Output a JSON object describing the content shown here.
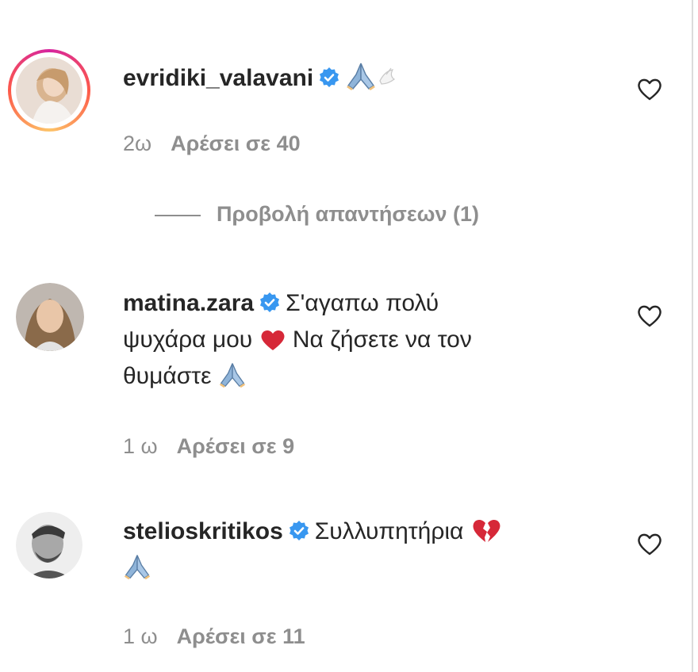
{
  "comments": [
    {
      "username": "evridiki_valavani",
      "text": "",
      "emoji": "praying-hands, dove",
      "age": "2ω",
      "likes": "Αρέσει σε 40",
      "has_story_ring": true,
      "view_replies": "Προβολή απαντήσεων (1)"
    },
    {
      "username": "matina.zara",
      "text_line1": "Σ'αγαπω πολύ",
      "text_line2a": "ψυχάρα μου",
      "text_line2b": "Να ζήσετε να τον",
      "text_line3": "θυμάστε",
      "age": "1 ω",
      "likes": "Αρέσει σε 9"
    },
    {
      "username": "stelioskritikos",
      "text": "Συλλυπητήρια",
      "age": "1 ω",
      "likes": "Αρέσει σε 11"
    }
  ],
  "colors": {
    "text": "#262626",
    "secondary": "#8e8e8e",
    "verified": "#3897f0",
    "heart_red": "#e0245e",
    "border": "#dbdbdb"
  }
}
